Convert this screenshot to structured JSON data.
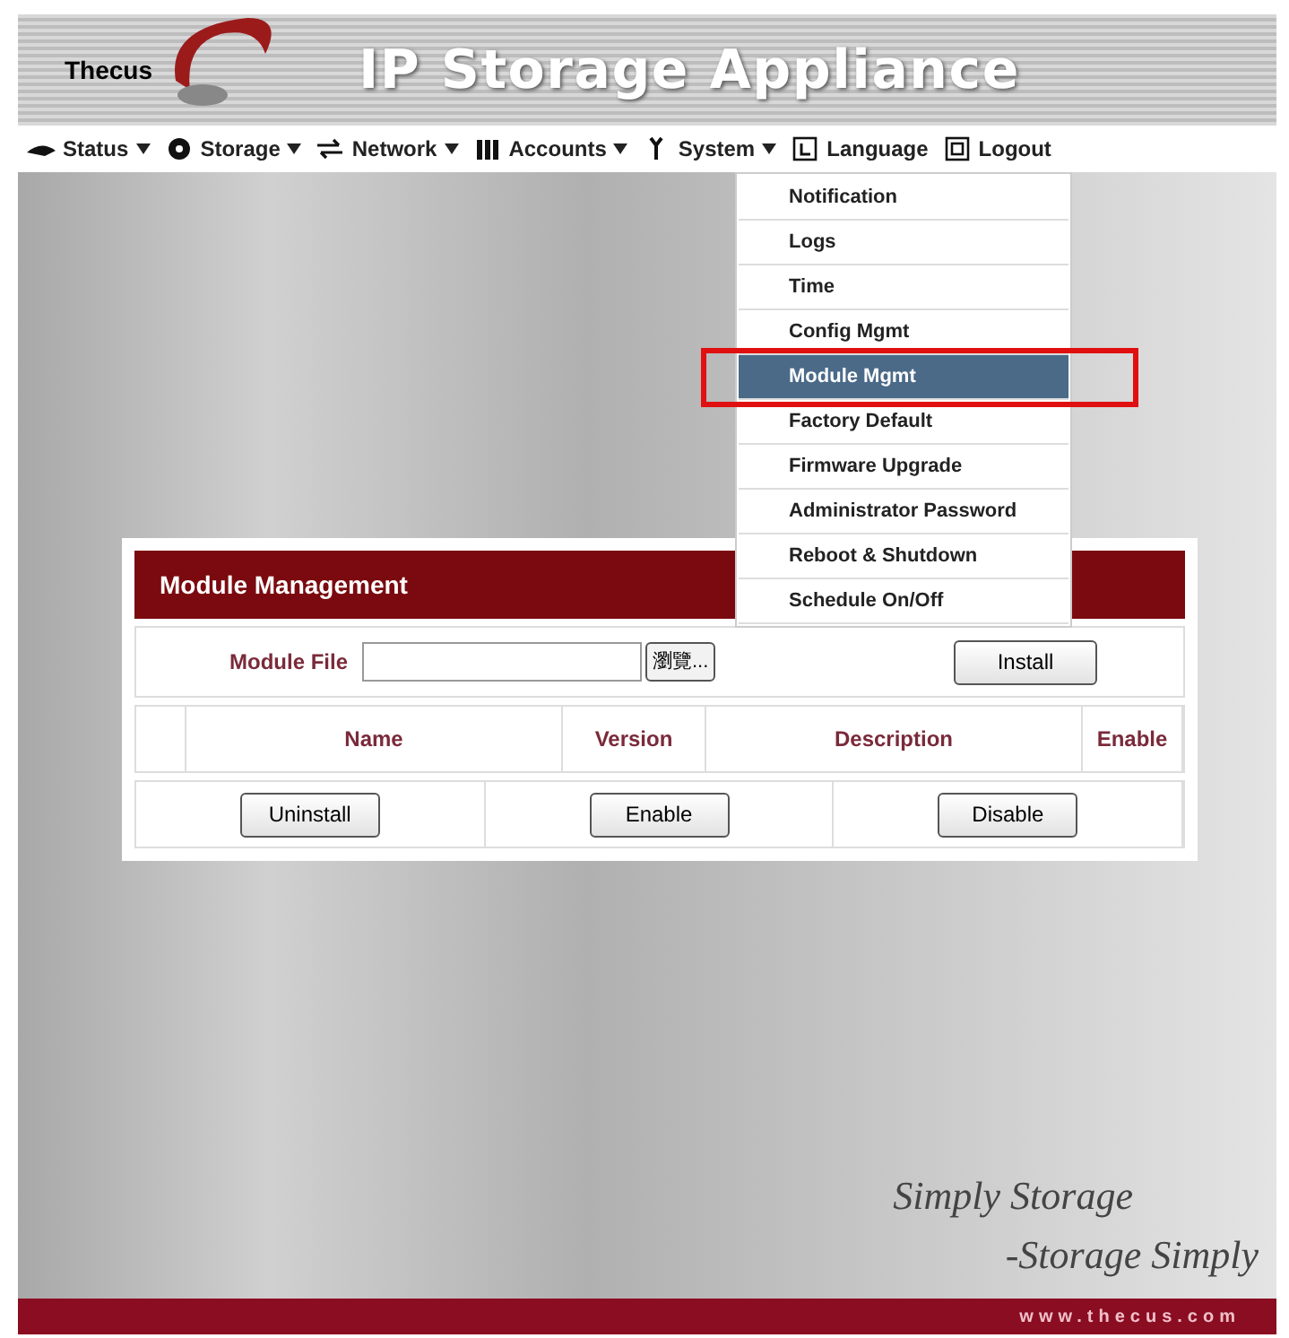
{
  "header": {
    "logo": "Thecus",
    "title": "IP Storage Appliance"
  },
  "nav": [
    {
      "label": "Status",
      "dropdown": true
    },
    {
      "label": "Storage",
      "dropdown": true
    },
    {
      "label": "Network",
      "dropdown": true
    },
    {
      "label": "Accounts",
      "dropdown": true
    },
    {
      "label": "System",
      "dropdown": true
    },
    {
      "label": "Language",
      "dropdown": false
    },
    {
      "label": "Logout",
      "dropdown": false
    }
  ],
  "system_menu": [
    {
      "label": "Notification",
      "selected": false,
      "callout": false
    },
    {
      "label": "Logs",
      "selected": false,
      "callout": false
    },
    {
      "label": "Time",
      "selected": false,
      "callout": false
    },
    {
      "label": "Config Mgmt",
      "selected": false,
      "callout": false
    },
    {
      "label": "Module Mgmt",
      "selected": true,
      "callout": true
    },
    {
      "label": "Factory Default",
      "selected": false,
      "callout": false
    },
    {
      "label": "Firmware Upgrade",
      "selected": false,
      "callout": false
    },
    {
      "label": "Administrator Password",
      "selected": false,
      "callout": false
    },
    {
      "label": "Reboot & Shutdown",
      "selected": false,
      "callout": false
    },
    {
      "label": "Schedule On/Off",
      "selected": false,
      "callout": false
    }
  ],
  "panel": {
    "title": "Module Management",
    "file_label": "Module File",
    "browse_button": "瀏覽...",
    "install_button": "Install",
    "columns": [
      "Name",
      "Version",
      "Description",
      "Enable"
    ],
    "action_buttons": [
      "Uninstall",
      "Enable",
      "Disable"
    ]
  },
  "footer": {
    "slogan_1": "Simply Storage",
    "slogan_2": "-Storage Simply",
    "url": "www.thecus.com"
  }
}
